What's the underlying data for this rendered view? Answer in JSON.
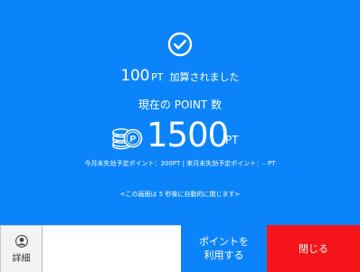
{
  "points_added": {
    "value": "100",
    "unit": "PT",
    "message": "加算されました"
  },
  "current_points": {
    "title": "現在の POINT 数",
    "value": "1500",
    "unit": "PT"
  },
  "expiry_info": "今月末失効予定ポイント：300PT | 来月末失効予定ポイント：– PT",
  "auto_close_message": "<この画面は 5 秒後に自動的に閉じます>",
  "bottom_bar": {
    "detail_label": "詳細",
    "use_points_label_line1": "ポイントを",
    "use_points_label_line2": "利用する",
    "close_label": "閉じる"
  },
  "icons": {
    "success": "check-circle-icon",
    "points": "coin-stack-icon",
    "detail": "person-icon"
  },
  "colors": {
    "accent_blue": "#0b84fb",
    "close_red": "#f41419",
    "text_on_accent": "#ffffff"
  }
}
